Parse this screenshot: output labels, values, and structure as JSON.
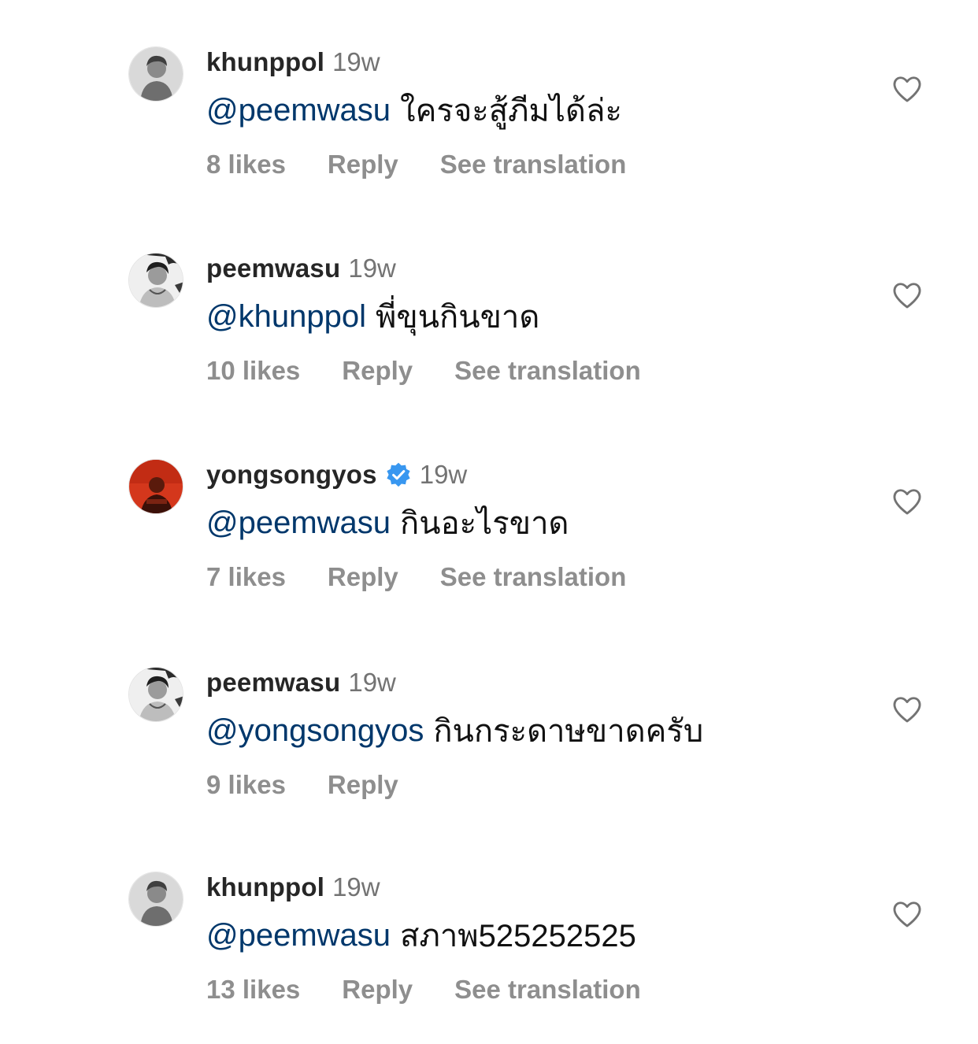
{
  "colors": {
    "username": "#262626",
    "timestamp": "#737373",
    "mention": "#00376b",
    "meta": "#8e8e8e",
    "verified": "#3897f0"
  },
  "icons": {
    "like": "heart-outline-icon",
    "verified": "verified-badge-icon"
  },
  "comments": [
    {
      "username": "khunppol",
      "verified": false,
      "time": "19w",
      "mention": "@peemwasu",
      "text": "ใครจะสู้ภีมได้ล่ะ",
      "likes": "8 likes",
      "reply_label": "Reply",
      "translation_label": "See translation"
    },
    {
      "username": "peemwasu",
      "verified": false,
      "time": "19w",
      "mention": "@khunppol",
      "text": "พี่ขุนกินขาด",
      "likes": "10 likes",
      "reply_label": "Reply",
      "translation_label": "See translation"
    },
    {
      "username": "yongsongyos",
      "verified": true,
      "time": "19w",
      "mention": "@peemwasu",
      "text": "กินอะไรขาด",
      "likes": "7 likes",
      "reply_label": "Reply",
      "translation_label": "See translation"
    },
    {
      "username": "peemwasu",
      "verified": false,
      "time": "19w",
      "mention": "@yongsongyos",
      "text": "กินกระดาษขาดครับ",
      "likes": "9 likes",
      "reply_label": "Reply",
      "translation_label": ""
    },
    {
      "username": "khunppol",
      "verified": false,
      "time": "19w",
      "mention": "@peemwasu",
      "text": "สภาพ525252525",
      "likes": "13 likes",
      "reply_label": "Reply",
      "translation_label": "See translation"
    }
  ]
}
